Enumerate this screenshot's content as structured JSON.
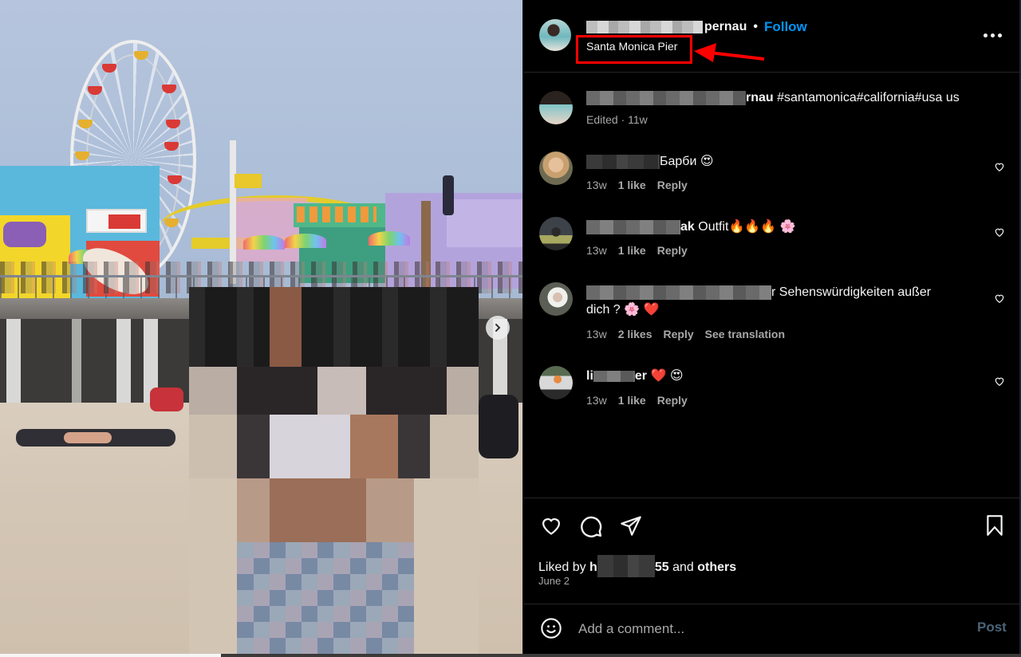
{
  "post": {
    "owner": {
      "username_visible_suffix": "pernau",
      "separator": "•",
      "follow_label": "Follow",
      "location": "Santa Monica Pier"
    },
    "more_options_icon": "more-horizontal-icon",
    "annotation": {
      "highlight_color": "#ff0000",
      "arrow_color": "#ff0000"
    },
    "image": {
      "description": "Santa Monica Pier beach photo with ferris wheel, Pacific Park roller coaster; person pixelated",
      "next_icon": "chevron-right-icon"
    },
    "caption": {
      "username_visible_suffix": "rnau",
      "text": "#santamonica#california#usa us",
      "meta": "Edited · 11w"
    },
    "comments": [
      {
        "username_visible_suffix": "",
        "text": "Барби 😍",
        "time": "13w",
        "likes": "1 like",
        "reply": "Reply",
        "translate": ""
      },
      {
        "username_visible_suffix": "ak",
        "text": "Outfit🔥🔥🔥 🌸",
        "time": "13w",
        "likes": "1 like",
        "reply": "Reply",
        "translate": ""
      },
      {
        "username_visible_suffix": "",
        "text": "r Sehenswürdigkeiten außer dich ? 🌸 ❤️",
        "time": "13w",
        "likes": "2 likes",
        "reply": "Reply",
        "translate": "See translation"
      },
      {
        "username_visible_prefix": "li",
        "username_visible_suffix": "er",
        "text": "❤️ 😍",
        "time": "13w",
        "likes": "1 like",
        "reply": "Reply",
        "translate": ""
      }
    ],
    "actions": {
      "like_icon": "heart-icon",
      "comment_icon": "comment-icon",
      "share_icon": "send-icon",
      "save_icon": "bookmark-icon"
    },
    "liked_by": {
      "prefix": "Liked by ",
      "user_visible_start": "h",
      "user_visible_end": "55",
      "middle": " and ",
      "others": "others"
    },
    "date": "June 2",
    "add_comment": {
      "emoji_icon": "emoji-smile-icon",
      "placeholder": "Add a comment...",
      "post_label": "Post",
      "post_color": "#4b6478"
    },
    "colors": {
      "background": "#000000",
      "text": "#f5f5f5",
      "secondary_text": "#a8a8a8",
      "follow_blue": "#0095f6",
      "divider": "#262626"
    }
  }
}
